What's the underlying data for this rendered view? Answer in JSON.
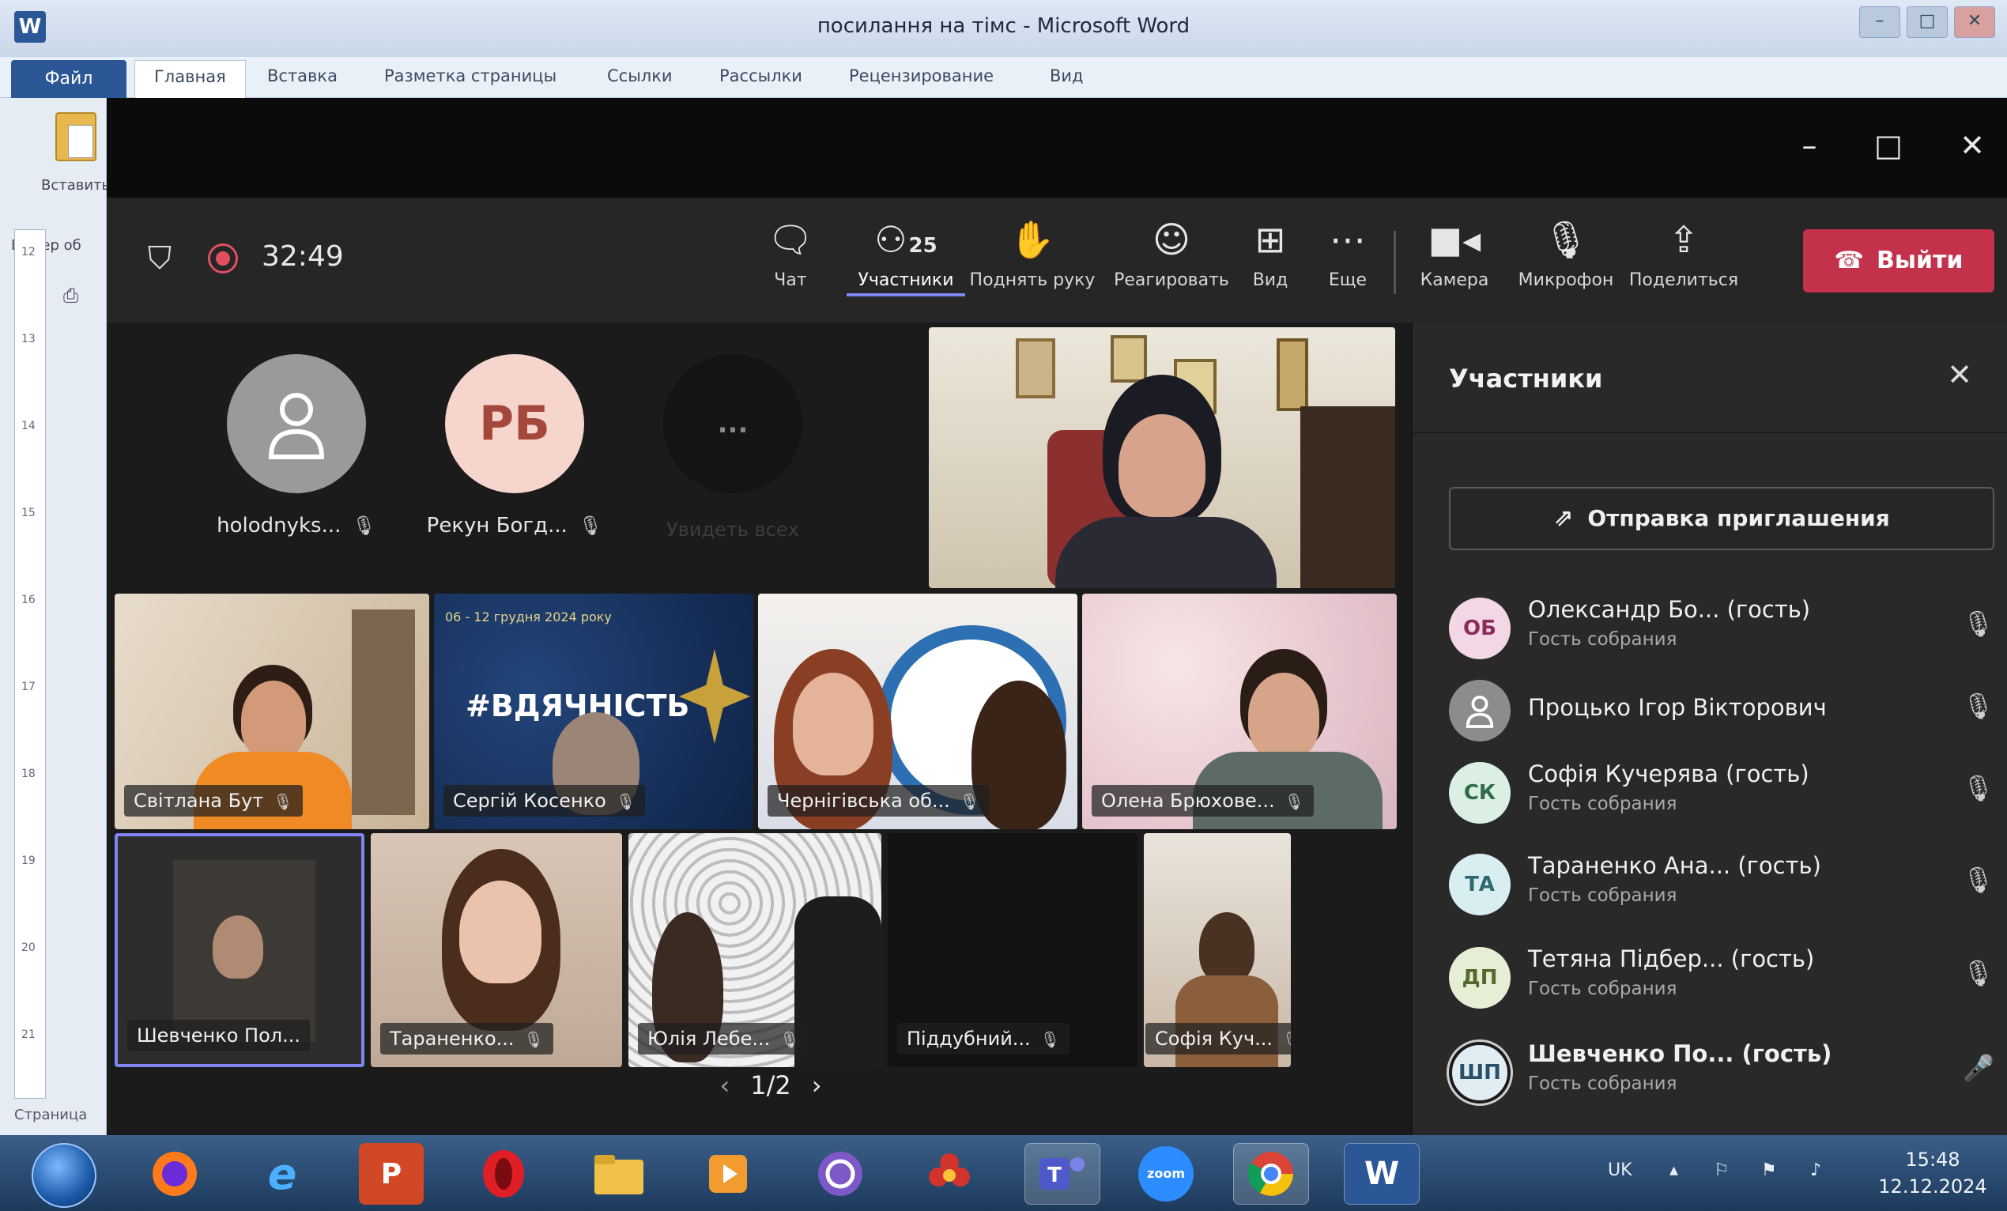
{
  "word": {
    "title": "посилання на тімс - Microsoft Word",
    "file_tab": "Файл",
    "tabs": [
      "Главная",
      "Вставка",
      "Разметка страницы",
      "Ссылки",
      "Рассылки",
      "Рецензирование",
      "Вид"
    ],
    "paste_label": "Вставить",
    "clipboard_label": "Буфер об",
    "status": "Страница",
    "ruler_marks": [
      "12",
      "13",
      "14",
      "15",
      "16",
      "17",
      "18",
      "19",
      "20",
      "21"
    ]
  },
  "teams": {
    "timer": "32:49",
    "toolbar": {
      "chat": "Чат",
      "participants": "Участники",
      "participants_count": "25",
      "raise_hand": "Поднять руку",
      "react": "Реагировать",
      "view": "Вид",
      "more": "Еще",
      "camera": "Камера",
      "mic": "Микрофон",
      "share": "Поделиться",
      "leave": "Выйти"
    },
    "top_avatars": [
      {
        "name": "holodnyks...",
        "initials": ""
      },
      {
        "name": "Рекун Богд...",
        "initials": "РБ"
      },
      {
        "name": "Увидеть всех",
        "initials": "..."
      }
    ],
    "tiles": [
      {
        "name": "Світлана Бут"
      },
      {
        "name": "Сергій Косенко",
        "banner": "#ВДЯЧНІСТЬ",
        "banner_sub": "06 - 12 грудня 2024 року"
      },
      {
        "name": "Чернігівська об..."
      },
      {
        "name": "Олена Брюхове..."
      },
      {
        "name": "Шевченко Пол..."
      },
      {
        "name": "Тараненко..."
      },
      {
        "name": "Юлія Лебе..."
      },
      {
        "name": "Піддубний..."
      },
      {
        "name": "Софія Куч..."
      }
    ],
    "pager": "1/2",
    "panel": {
      "title": "Участники",
      "invite": "Отправка приглашения",
      "people": [
        {
          "initials": "ОБ",
          "name": "Олександр Бо... (гость)",
          "sub": "Гость собрания",
          "color": "#f3d7e6",
          "text_color": "#8a2d5a"
        },
        {
          "initials": "",
          "name": "Процько Ігор Вікторович",
          "sub": "",
          "color": "#8c8c8c",
          "text_color": "#ffffff"
        },
        {
          "initials": "СК",
          "name": "Софія Кучерява (гость)",
          "sub": "Гость собрания",
          "color": "#dcefe4",
          "text_color": "#2f6b47"
        },
        {
          "initials": "ТА",
          "name": "Тараненко Ана... (гость)",
          "sub": "Гость собрания",
          "color": "#d9eef0",
          "text_color": "#2e6870"
        },
        {
          "initials": "ДП",
          "name": "Тетяна Підбер... (гость)",
          "sub": "Гость собрания",
          "color": "#e6eed6",
          "text_color": "#55692c"
        },
        {
          "initials": "ШП",
          "name": "Шевченко По... (гость)",
          "sub": "Гость собрания",
          "color": "#e1ecf3",
          "text_color": "#294f69"
        }
      ]
    }
  },
  "taskbar": {
    "apps": [
      "firefox",
      "internet-explorer",
      "powerpoint",
      "opera",
      "file-explorer",
      "media-player",
      "viber",
      "other-app",
      "teams",
      "zoom",
      "chrome",
      "word"
    ],
    "zoom_label": "zoom",
    "word_label": "W",
    "lang": "UK",
    "time": "15:48",
    "date": "12.12.2024"
  }
}
